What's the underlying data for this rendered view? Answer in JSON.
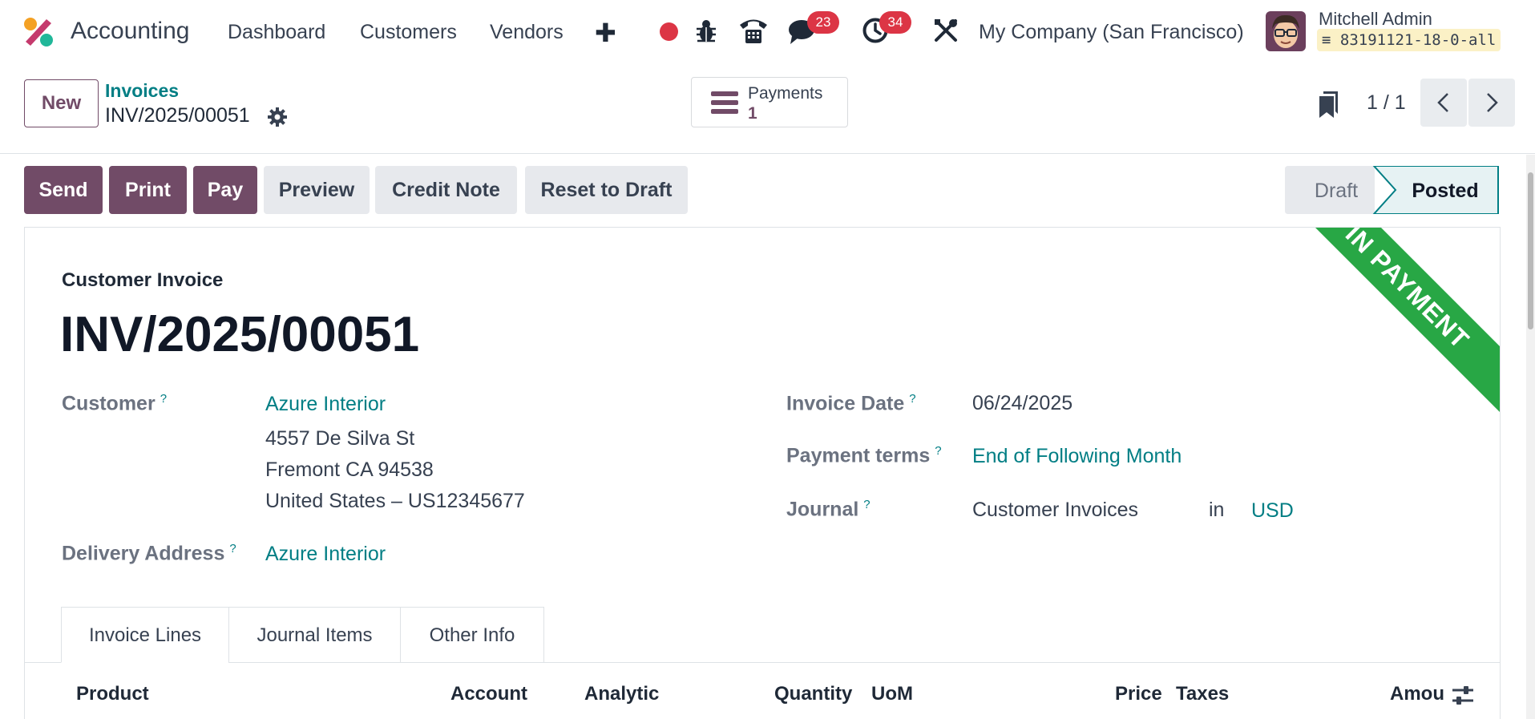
{
  "navbar": {
    "app_name": "Accounting",
    "menus": [
      "Dashboard",
      "Customers",
      "Vendors"
    ],
    "messages_badge": "23",
    "activities_badge": "34",
    "company": "My Company (San Francisco)",
    "user_name": "Mitchell Admin",
    "database": "83191121-18-0-all"
  },
  "control_panel": {
    "new_label": "New",
    "breadcrumb": "Invoices",
    "record": "INV/2025/00051",
    "smart_button": {
      "label": "Payments",
      "value": "1"
    },
    "pager": "1 / 1"
  },
  "actions": {
    "send": "Send",
    "print": "Print",
    "pay": "Pay",
    "preview": "Preview",
    "credit_note": "Credit Note",
    "reset": "Reset to Draft"
  },
  "status": {
    "stages": [
      "Draft",
      "Posted"
    ],
    "current": "Posted"
  },
  "ribbon": "IN PAYMENT",
  "form": {
    "doc_type": "Customer Invoice",
    "title": "INV/2025/00051",
    "customer_label": "Customer",
    "customer": "Azure Interior",
    "address": [
      "4557 De Silva St",
      "Fremont CA 94538",
      "United States – US12345677"
    ],
    "delivery_label": "Delivery Address",
    "delivery": "Azure Interior",
    "invoice_date_label": "Invoice Date",
    "invoice_date": "06/24/2025",
    "payment_terms_label": "Payment terms",
    "payment_terms": "End of Following Month",
    "journal_label": "Journal",
    "journal": "Customer Invoices",
    "journal_in": "in",
    "currency": "USD",
    "help_mark": "?"
  },
  "tabs": [
    "Invoice Lines",
    "Journal Items",
    "Other Info"
  ],
  "table_headers": {
    "product": "Product",
    "account": "Account",
    "analytic": "Analytic",
    "quantity": "Quantity",
    "uom": "UoM",
    "price": "Price",
    "taxes": "Taxes",
    "amount": "Amou"
  },
  "colors": {
    "primary": "#714b67",
    "link": "#017e84",
    "ribbon": "#28a745",
    "badge": "#dc3545"
  },
  "icons": [
    "app-logo-icon",
    "plus-icon",
    "record-icon",
    "bug-icon",
    "phone-icon",
    "chat-icon",
    "clock-icon",
    "tools-icon",
    "gear-icon",
    "list-icon",
    "bookmark-icon",
    "chevron-left-icon",
    "chevron-right-icon",
    "column-settings-icon"
  ]
}
